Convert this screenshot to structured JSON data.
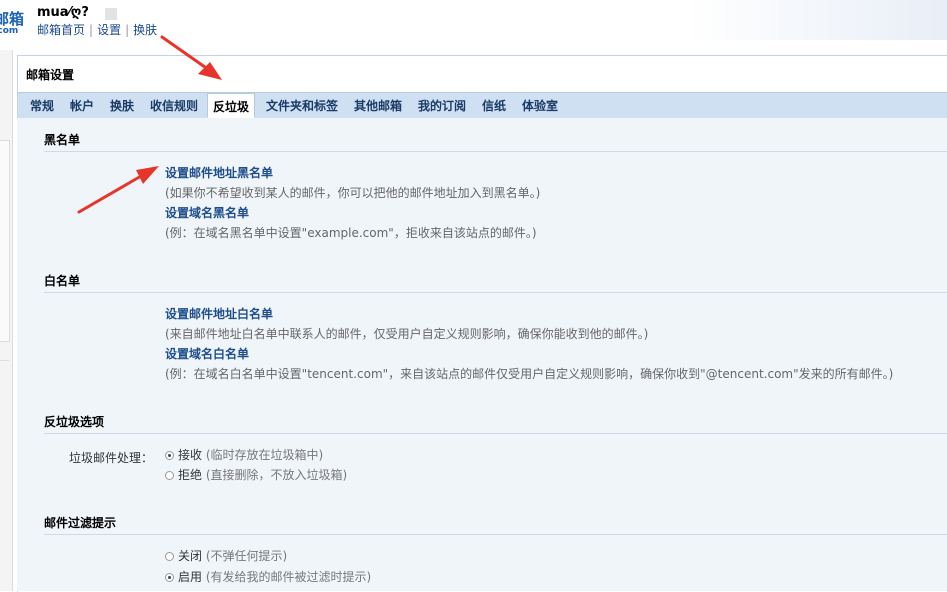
{
  "header": {
    "logo_line1": "邮箱",
    "logo_line2": ".com",
    "username": "mua⁄ღ?",
    "nav": {
      "home": "邮箱首页",
      "settings": "设置",
      "skin": "换肤",
      "sep": "|"
    }
  },
  "panel": {
    "title": "邮箱设置"
  },
  "tabs": [
    "常规",
    "帐户",
    "换肤",
    "收信规则",
    "反垃圾",
    "文件夹和标签",
    "其他邮箱",
    "我的订阅",
    "信纸",
    "体验室"
  ],
  "active_tab": "反垃圾",
  "blacklist": {
    "heading": "黑名单",
    "address_link": "设置邮件地址黑名单",
    "address_desc": "(如果你不希望收到某人的邮件，你可以把他的邮件地址加入到黑名单。)",
    "domain_link": "设置域名黑名单",
    "domain_desc": "(例：在域名黑名单中设置\"example.com\"，拒收来自该站点的邮件。)"
  },
  "whitelist": {
    "heading": "白名单",
    "address_link": "设置邮件地址白名单",
    "address_desc": "(来自邮件地址白名单中联系人的邮件，仅受用户自定义规则影响，确保你能收到他的邮件。)",
    "domain_link": "设置域名白名单",
    "domain_desc": "(例：在域名白名单中设置\"tencent.com\"，来自该站点的邮件仅受用户自定义规则影响，确保你收到\"@tencent.com\"发来的所有邮件。)"
  },
  "antispam": {
    "heading": "反垃圾选项",
    "label": "垃圾邮件处理：",
    "options": [
      {
        "label": "接收",
        "note": "(临时存放在垃圾箱中)",
        "checked": true
      },
      {
        "label": "拒绝",
        "note": "(直接删除，不放入垃圾箱)",
        "checked": false
      }
    ]
  },
  "filter_notice": {
    "heading": "邮件过滤提示",
    "options": [
      {
        "label": "关闭",
        "note": "(不弹任何提示)",
        "checked": false
      },
      {
        "label": "启用",
        "note": "(有发给我的邮件被过滤时提示)",
        "checked": true
      }
    ]
  },
  "colors": {
    "accent": "#1e4e8c",
    "tab_bg": "#cfe0f2",
    "content_bg": "#f0f5fa",
    "annotation": "#e8352b"
  }
}
